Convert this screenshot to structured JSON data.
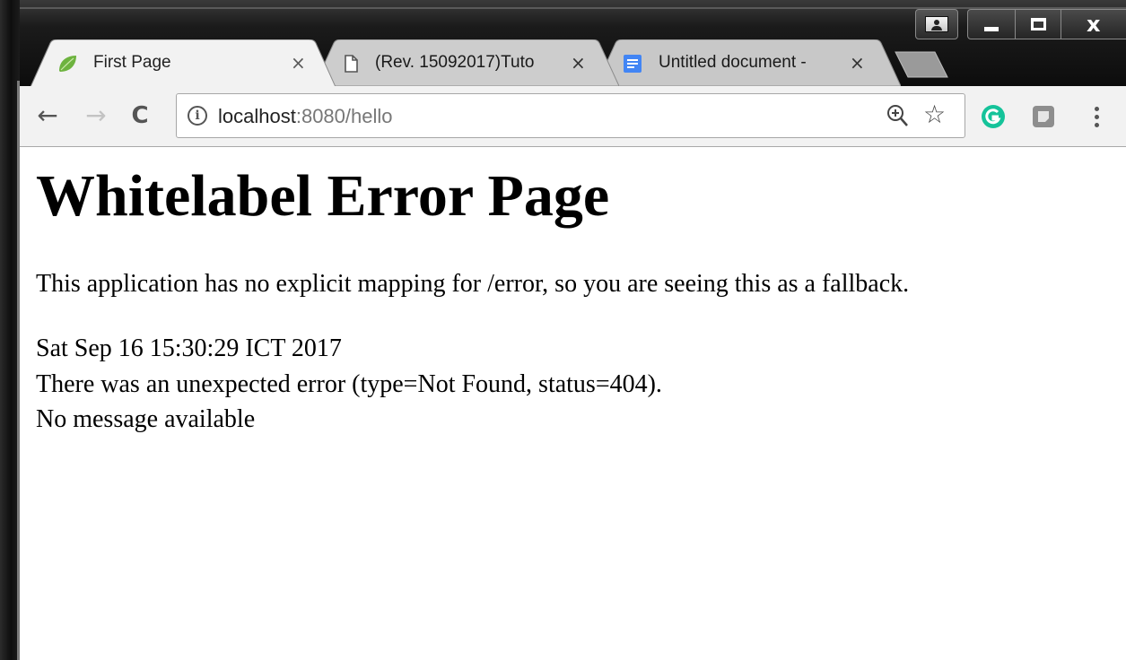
{
  "tabs": [
    {
      "title": "First Page",
      "close": "×",
      "icon": "spring-leaf-icon",
      "active": true
    },
    {
      "title": "(Rev. 15092017)Tuto",
      "close": "×",
      "icon": "document-icon",
      "active": false
    },
    {
      "title": "Untitled document -",
      "close": "×",
      "icon": "google-docs-icon",
      "active": false
    }
  ],
  "window_controls": {
    "close": "x"
  },
  "toolbar": {
    "back": "←",
    "forward": "→",
    "reload": "C",
    "info": "i",
    "url_host": "localhost",
    "url_path": ":8080/hello",
    "star": "☆"
  },
  "page": {
    "heading": "Whitelabel Error Page",
    "explanation": "This application has no explicit mapping for /error, so you are seeing this as a fallback.",
    "timestamp": "Sat Sep 16 15:30:29 ICT 2017",
    "error": "There was an unexpected error (type=Not Found, status=404).",
    "message": "No message available"
  },
  "colors": {
    "toolbar_bg": "#f2f2f2",
    "titlebar_bg": "#0c0c0c",
    "grammarly": "#15c39a",
    "docs_blue": "#4285f4",
    "spring_green": "#6db33f"
  }
}
